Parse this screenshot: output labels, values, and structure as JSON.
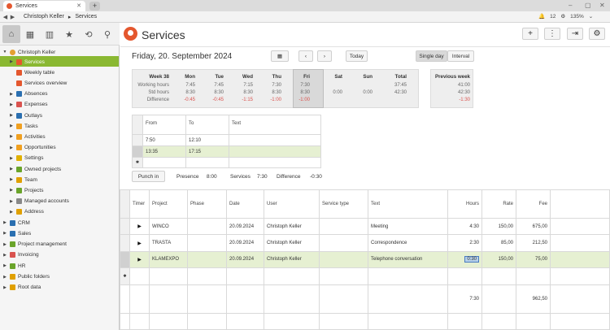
{
  "browser": {
    "tab_title": "Services",
    "new_tab": "+",
    "window_controls": [
      "‒",
      "▢",
      "✕"
    ],
    "breadcrumb": [
      "Christoph Keller",
      "Services"
    ],
    "notif_count": "12",
    "zoom": "135%"
  },
  "sidebar": {
    "user": "Christoph Keller",
    "items": [
      {
        "label": "Services",
        "color": "#e4572e"
      },
      {
        "label": "Weekly table",
        "color": "#e4572e"
      },
      {
        "label": "Services overview",
        "color": "#e4572e"
      },
      {
        "label": "Absences",
        "color": "#2a6fb0"
      },
      {
        "label": "Expenses",
        "color": "#d9534f"
      },
      {
        "label": "Outlays",
        "color": "#2a6fb0"
      },
      {
        "label": "Tasks",
        "color": "#f0a020"
      },
      {
        "label": "Activities",
        "color": "#f0a020"
      },
      {
        "label": "Opportunities",
        "color": "#f0a020"
      },
      {
        "label": "Settings",
        "color": "#e0b000"
      },
      {
        "label": "Owned projects",
        "color": "#6aa42a"
      },
      {
        "label": "Team",
        "color": "#e0a000"
      },
      {
        "label": "Projects",
        "color": "#6aa42a"
      },
      {
        "label": "Managed accounts",
        "color": "#888888"
      },
      {
        "label": "Address",
        "color": "#e0a000"
      }
    ],
    "root_items": [
      {
        "label": "CRM",
        "color": "#2a6fb0"
      },
      {
        "label": "Sales",
        "color": "#2a6fb0"
      },
      {
        "label": "Project management",
        "color": "#6aa42a"
      },
      {
        "label": "Invoicing",
        "color": "#d9534f"
      },
      {
        "label": "HR",
        "color": "#6aa42a"
      },
      {
        "label": "Public folders",
        "color": "#e0a000"
      },
      {
        "label": "Root data",
        "color": "#e0a000"
      }
    ]
  },
  "header": {
    "title": "Services",
    "date": "Friday, 20. September 2024",
    "today_label": "Today",
    "single_day_label": "Single day",
    "interval_label": "Interval"
  },
  "week": {
    "title": "Week 38",
    "row_labels": [
      "Working hours",
      "Std hours",
      "Difference"
    ],
    "days": [
      {
        "name": "Mon",
        "work": "7:45",
        "std": "8:30",
        "diff": "-0:45"
      },
      {
        "name": "Tue",
        "work": "7:45",
        "std": "8:30",
        "diff": "-0:45"
      },
      {
        "name": "Wed",
        "work": "7:15",
        "std": "8:30",
        "diff": "-1:15"
      },
      {
        "name": "Thu",
        "work": "7:30",
        "std": "8:30",
        "diff": "-1:00"
      },
      {
        "name": "Fri",
        "work": "7:30",
        "std": "8:30",
        "diff": "-1:00"
      },
      {
        "name": "Sat",
        "work": "",
        "std": "0:00",
        "diff": ""
      },
      {
        "name": "Sun",
        "work": "",
        "std": "0:00",
        "diff": ""
      },
      {
        "name": "Total",
        "work": "37:45",
        "std": "42:30",
        "diff": ""
      }
    ],
    "prev_week": {
      "title": "Previous week",
      "work": "41:00",
      "std": "42:30",
      "diff": "-1:30"
    }
  },
  "times": {
    "headers": [
      "From",
      "To",
      "Text"
    ],
    "rows": [
      {
        "from": "7:50",
        "to": "12:10",
        "text": ""
      },
      {
        "from": "13:35",
        "to": "17:15",
        "text": ""
      }
    ],
    "new_row_marker": "✱"
  },
  "summary": {
    "punch_in": "Punch in",
    "presence_label": "Presence",
    "presence": "8:00",
    "services_label": "Services",
    "services": "7:30",
    "difference_label": "Difference",
    "difference": "-0:30"
  },
  "services": {
    "headers": [
      "Timer",
      "Project",
      "Phase",
      "Date",
      "User",
      "Service type",
      "Text",
      "Hours",
      "Rate",
      "Fee"
    ],
    "rows": [
      {
        "project": "WINCO",
        "phase": "",
        "date": "20.09.2024",
        "user": "Christoph Keller",
        "type": "",
        "text": "Meeting",
        "hours": "4:30",
        "rate": "150,00",
        "fee": "675,00"
      },
      {
        "project": "TRASTA",
        "phase": "",
        "date": "20.09.2024",
        "user": "Christoph Keller",
        "type": "",
        "text": "Correspondence",
        "hours": "2:30",
        "rate": "85,00",
        "fee": "212,50"
      },
      {
        "project": "KLAMEXPO",
        "phase": "",
        "date": "20.09.2024",
        "user": "Christoph Keller",
        "type": "",
        "text": "Telephone conversation",
        "hours": "0:30",
        "rate": "150,00",
        "fee": "75,00"
      }
    ],
    "new_row_marker": "✱",
    "total_hours": "7:30",
    "total_fee": "962,50"
  }
}
